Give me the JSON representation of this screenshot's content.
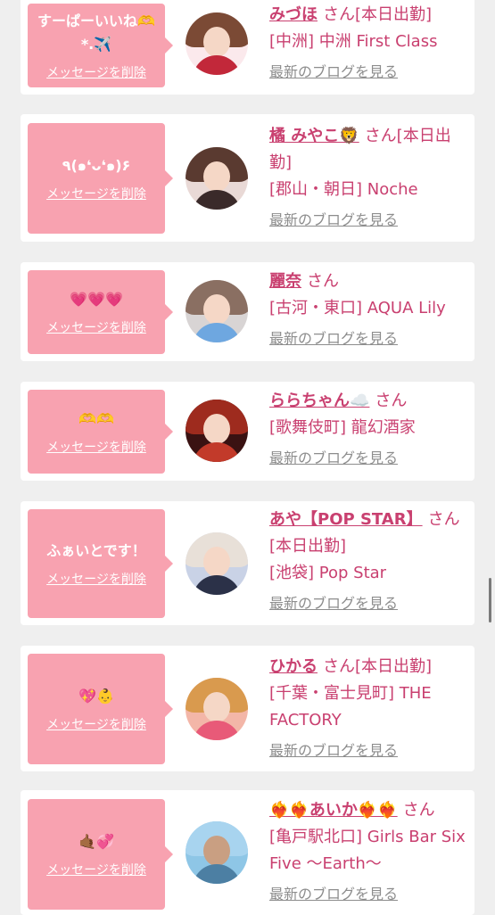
{
  "delete_label": "メッセージを削除",
  "blog_label": "最新のブログを見る",
  "cards": [
    {
      "message": "すーぱーいいね🫶 *.✈️",
      "name": "みづほ",
      "san": "さん[本日出勤]",
      "shop": "[中洲] 中洲 First Class"
    },
    {
      "message": "٩(๑❛ᴗ❛๑)۶",
      "name": "橘 みやこ🦁",
      "san": "さん[本日出勤]",
      "shop": "[郡山・朝日] Noche"
    },
    {
      "message": "💗💗💗",
      "name": "麗奈",
      "san": "さん",
      "shop": "[古河・東口] AQUA Lily"
    },
    {
      "message": "🫶🫶",
      "name": "ららちゃん☁️",
      "san": "さん",
      "shop": "[歌舞伎町] 龍幻酒家"
    },
    {
      "message": "ふぁいとです！",
      "name": "あや【POP STAR】",
      "san": "さん[本日出勤]",
      "shop": "[池袋] Pop Star"
    },
    {
      "message": "💖👶",
      "name": "ひかる",
      "san": "さん[本日出勤]",
      "shop": "[千葉・富士見町] THE FACTORY"
    },
    {
      "message": "🤙🏾💞",
      "name": "❤️‍🔥❤️‍🔥あいか❤️‍🔥❤️‍🔥",
      "san": "さん",
      "shop": "[亀戸駅北口] Girls Bar Six Five 〜Earth〜"
    }
  ]
}
